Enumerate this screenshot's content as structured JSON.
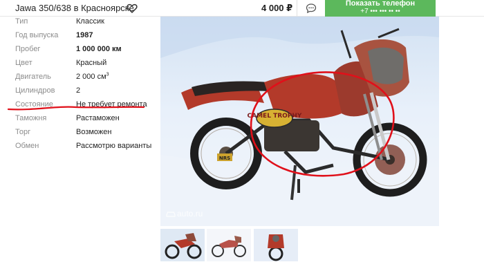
{
  "header": {
    "title": "Jawa 350/638 в Красноярске",
    "price": "4 000 ₽",
    "phone_button": {
      "label": "Показать телефон",
      "masked_number": "+7 ••• ••• •• ••"
    },
    "icons": {
      "favorite": "heart-outline-icon",
      "chat": "chat-bubble-icon"
    }
  },
  "specs": [
    {
      "label": "Тип",
      "value": "Классик"
    },
    {
      "label": "Год выпуска",
      "value": "1987"
    },
    {
      "label": "Пробег",
      "value": "1 000 000 км"
    },
    {
      "label": "Цвет",
      "value": "Красный"
    },
    {
      "label": "Двигатель",
      "value": "2 000 см",
      "sup": "3"
    },
    {
      "label": "Цилиндров",
      "value": "2"
    },
    {
      "label": "Состояние",
      "value": "Не требует ремонта"
    },
    {
      "label": "Таможня",
      "value": "Растаможен"
    },
    {
      "label": "Торг",
      "value": "Возможен"
    },
    {
      "label": "Обмен",
      "value": "Рассмотрю варианты"
    }
  ],
  "photo": {
    "watermark": "auto.ru",
    "badge_text": "CAMEL TROPHY",
    "plate_text": "NRS"
  },
  "thumbnails_count": 3,
  "colors": {
    "accent_green": "#5cb85c",
    "annotation_red": "#e0101a",
    "label_gray": "#8c8c8c",
    "motorcycle_red": "#b33a2a"
  }
}
